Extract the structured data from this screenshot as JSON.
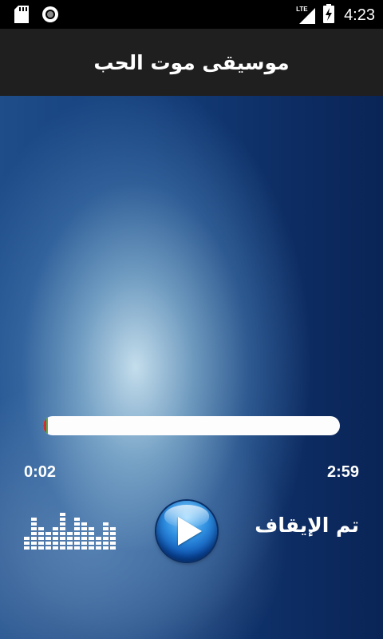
{
  "status_bar": {
    "time": "4:23",
    "network_type": "LTE",
    "icons": [
      "sd-card-icon",
      "record-icon",
      "signal-icon",
      "battery-charging-icon"
    ]
  },
  "app_bar": {
    "title": "موسيقى موت الحب"
  },
  "player": {
    "elapsed": "0:02",
    "duration": "2:59",
    "progress_fraction": 0.011,
    "status": "تم الإيقاف",
    "play_button_icon": "play-icon",
    "equalizer_levels": [
      3,
      7,
      5,
      4,
      5,
      8,
      4,
      7,
      6,
      5,
      3,
      6,
      5
    ],
    "colors": {
      "progress_start": "#d32f2f",
      "progress_end": "#4caf50",
      "appbar_bg": "#1f1f1f"
    }
  }
}
